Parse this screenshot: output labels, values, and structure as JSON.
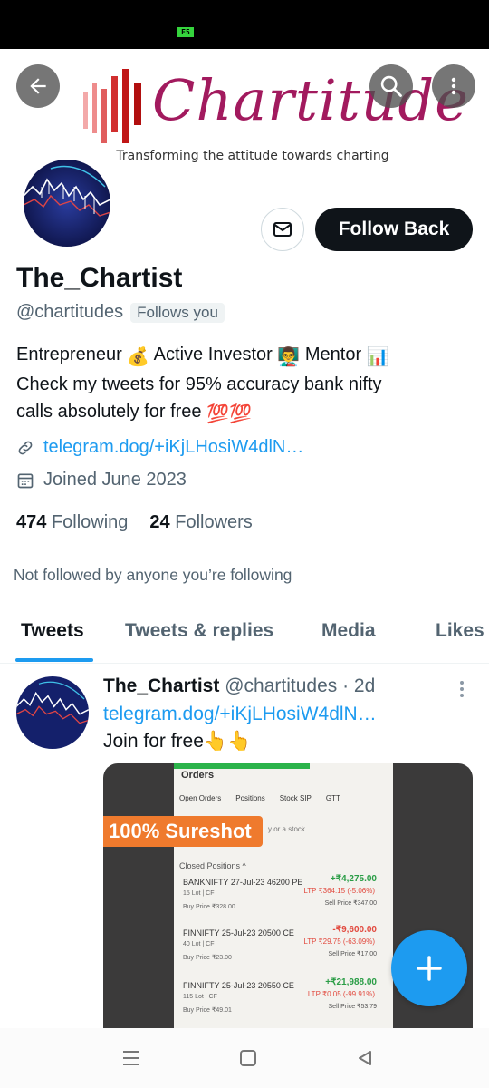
{
  "status_bar": {
    "battery": "E5"
  },
  "banner": {
    "logo_text": "Chartitude",
    "tagline": "Transforming the attitude towards charting"
  },
  "header_icons": {
    "back": "arrow-left-icon",
    "search": "search-icon",
    "more": "more-vertical-icon"
  },
  "profile": {
    "display_name": "The_Chartist",
    "handle": "@chartitudes",
    "follows_you": "Follows you",
    "follow_button": "Follow Back",
    "bio_line1_a": "Entrepreneur",
    "bio_line1_b": "Active Investor",
    "bio_line1_c": "Mentor",
    "bio_line2": "Check my tweets for 95% accuracy bank nifty",
    "bio_line3": "calls absolutely for free",
    "bio_emoji_100": "💯💯",
    "link": "telegram.dog/+iKjLHosiW4dlN…",
    "joined": "Joined June 2023",
    "following_count": "474",
    "following_label": "Following",
    "followers_count": "24",
    "followers_label": "Followers",
    "not_followed": "Not followed by anyone you’re following"
  },
  "tabs": [
    {
      "label": "Tweets",
      "active": true
    },
    {
      "label": "Tweets & replies",
      "active": false
    },
    {
      "label": "Media",
      "active": false
    },
    {
      "label": "Likes",
      "active": false
    }
  ],
  "tweet": {
    "name": "The_Chartist",
    "handle_time": "@chartitudes · 2d",
    "link": "telegram.dog/+iKjLHosiW4dlN…",
    "text": "Join for free",
    "text_emoji": "👆👆",
    "media": {
      "overlay_label": "100% Sureshot",
      "screen_title": "Orders",
      "screen_tabs": [
        "Open Orders",
        "Positions",
        "Stock SIP",
        "GTT"
      ],
      "search_hint": "y or a stock",
      "closed_positions": "Closed Positions ^",
      "positions": [
        {
          "name": "BANKNIFTY 27-Jul-23 46200 PE",
          "pnl": "+₹4,275.00",
          "lots": "15 Lot | CF",
          "ltp": "LTP ₹364.15 (-5.06%)",
          "buy": "Buy Price ₹328.00",
          "sell": "Sell Price ₹347.00"
        },
        {
          "name": "FINNIFTY 25-Jul-23 20500 CE",
          "pnl": "-₹9,600.00",
          "lots": "40 Lot | CF",
          "ltp": "LTP ₹29.75 (-63.09%)",
          "buy": "Buy Price ₹23.00",
          "sell": "Sell Price ₹17.00"
        },
        {
          "name": "FINNIFTY 25-Jul-23 20550 CE",
          "pnl": "+₹21,988.00",
          "lots": "115 Lot | CF",
          "ltp": "LTP ₹0.05 (-99.91%)",
          "buy": "Buy Price ₹49.01",
          "sell": "Sell Price ₹53.79"
        }
      ]
    }
  },
  "colors": {
    "accent": "#1d9bf0",
    "text": "#0f1419",
    "muted": "#536471",
    "brand": "#a21a5e"
  }
}
